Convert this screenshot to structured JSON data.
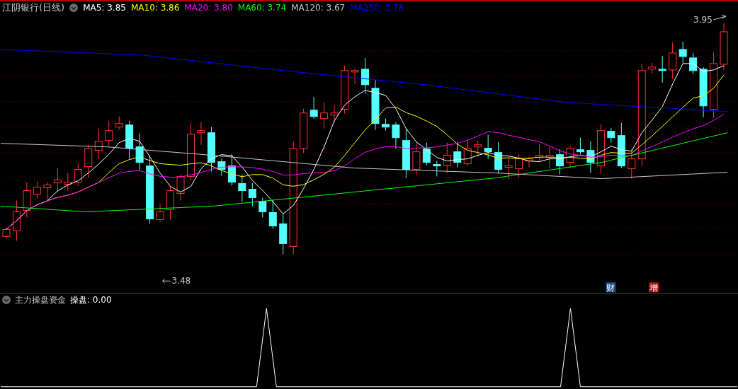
{
  "title": "江阴银行(日线)",
  "moving_averages": [
    {
      "label": "MA5: 3.85",
      "color": "#ffffff"
    },
    {
      "label": "MA10: 3.86",
      "color": "#ffff00"
    },
    {
      "label": "MA20: 3.80",
      "color": "#ff00ff"
    },
    {
      "label": "MA60: 3.74",
      "color": "#00ff00"
    },
    {
      "label": "MA120: 3.67",
      "color": "#c8c8c8"
    },
    {
      "label": "MA250: 3.78",
      "color": "#0000ff"
    }
  ],
  "high_label": "3.95",
  "low_label": "3.48",
  "markers": [
    {
      "label": "财",
      "color": "#1c4f8c"
    },
    {
      "label": "增",
      "color": "#b01010"
    }
  ],
  "indicator": {
    "title": "主力操盘资金",
    "reading": "操盘: 0.00"
  }
}
